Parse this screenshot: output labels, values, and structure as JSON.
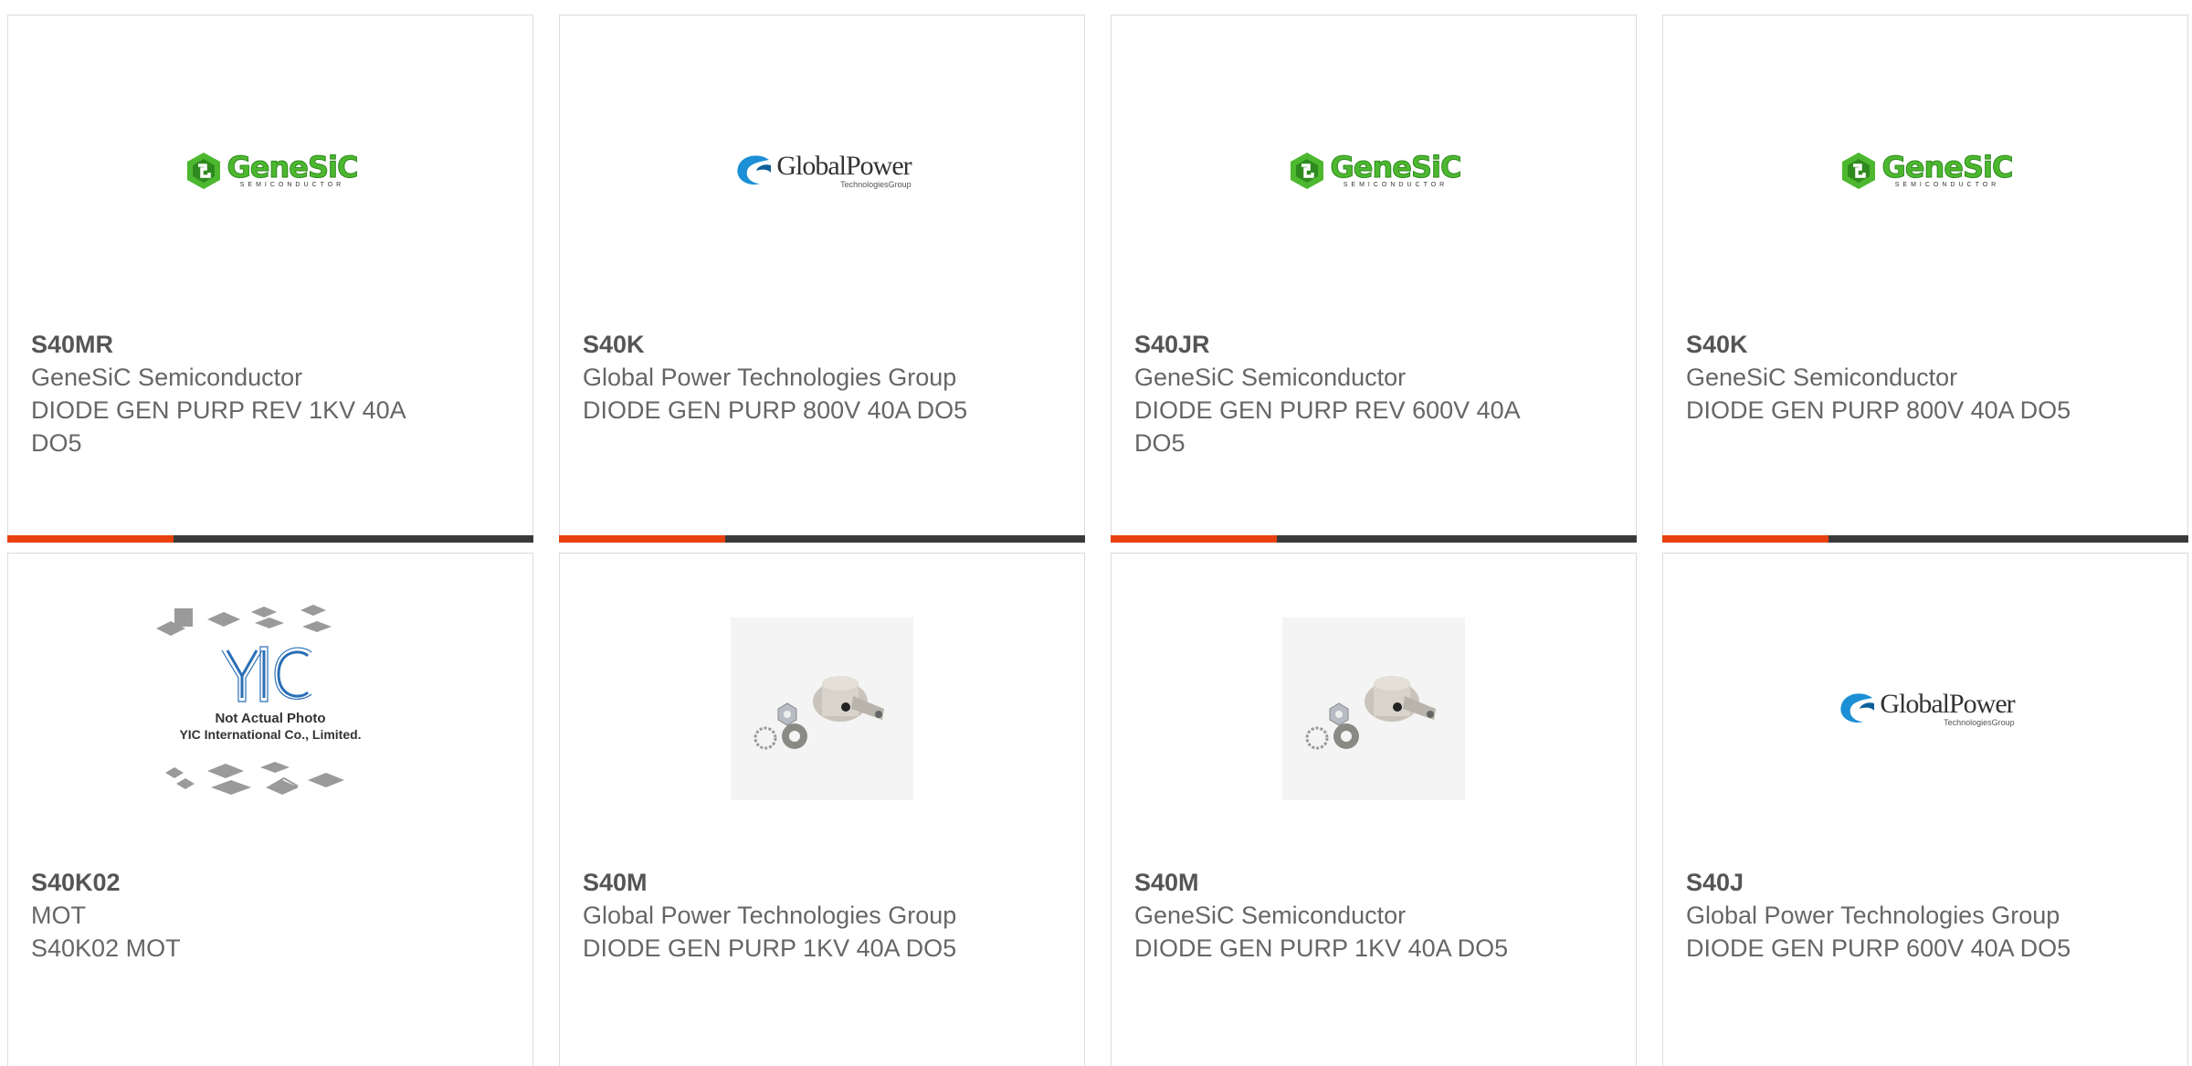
{
  "brand": {
    "accent_color": "#e8410f",
    "bar_color": "#3a3a3a",
    "genesic_green": "#4db82f",
    "global_blue": "#1c8fd6"
  },
  "cards": [
    {
      "image": "genesic-logo",
      "logo_word": "GeneSiC",
      "logo_sub": "SEMICONDUCTOR",
      "part": "S40MR",
      "manufacturer": "GeneSiC Semiconductor",
      "description": "DIODE GEN PURP REV 1KV 40A DO5"
    },
    {
      "image": "globalpower-logo",
      "logo_word": "GlobalPower",
      "logo_sub": "TechnologiesGroup",
      "part": "S40K",
      "manufacturer": "Global Power Technologies Group",
      "description": "DIODE GEN PURP 800V 40A DO5"
    },
    {
      "image": "genesic-logo",
      "logo_word": "GeneSiC",
      "logo_sub": "SEMICONDUCTOR",
      "part": "S40JR",
      "manufacturer": "GeneSiC Semiconductor",
      "description": "DIODE GEN PURP REV 600V 40A DO5"
    },
    {
      "image": "genesic-logo",
      "logo_word": "GeneSiC",
      "logo_sub": "SEMICONDUCTOR",
      "part": "S40K",
      "manufacturer": "GeneSiC Semiconductor",
      "description": "DIODE GEN PURP 800V 40A DO5"
    },
    {
      "image": "yic-placeholder",
      "logo_word": "YIC",
      "photo_note_1": "Not Actual Photo",
      "photo_note_2": "YIC International Co., Limited.",
      "part": "S40K02",
      "manufacturer": "MOT",
      "description": "S40K02 MOT"
    },
    {
      "image": "diode-photo",
      "part": "S40M",
      "manufacturer": "Global Power Technologies Group",
      "description": "DIODE GEN PURP 1KV 40A DO5"
    },
    {
      "image": "diode-photo",
      "part": "S40M",
      "manufacturer": "GeneSiC Semiconductor",
      "description": "DIODE GEN PURP 1KV 40A DO5"
    },
    {
      "image": "globalpower-logo",
      "logo_word": "GlobalPower",
      "logo_sub": "TechnologiesGroup",
      "part": "S40J",
      "manufacturer": "Global Power Technologies Group",
      "description": "DIODE GEN PURP 600V 40A DO5"
    }
  ]
}
